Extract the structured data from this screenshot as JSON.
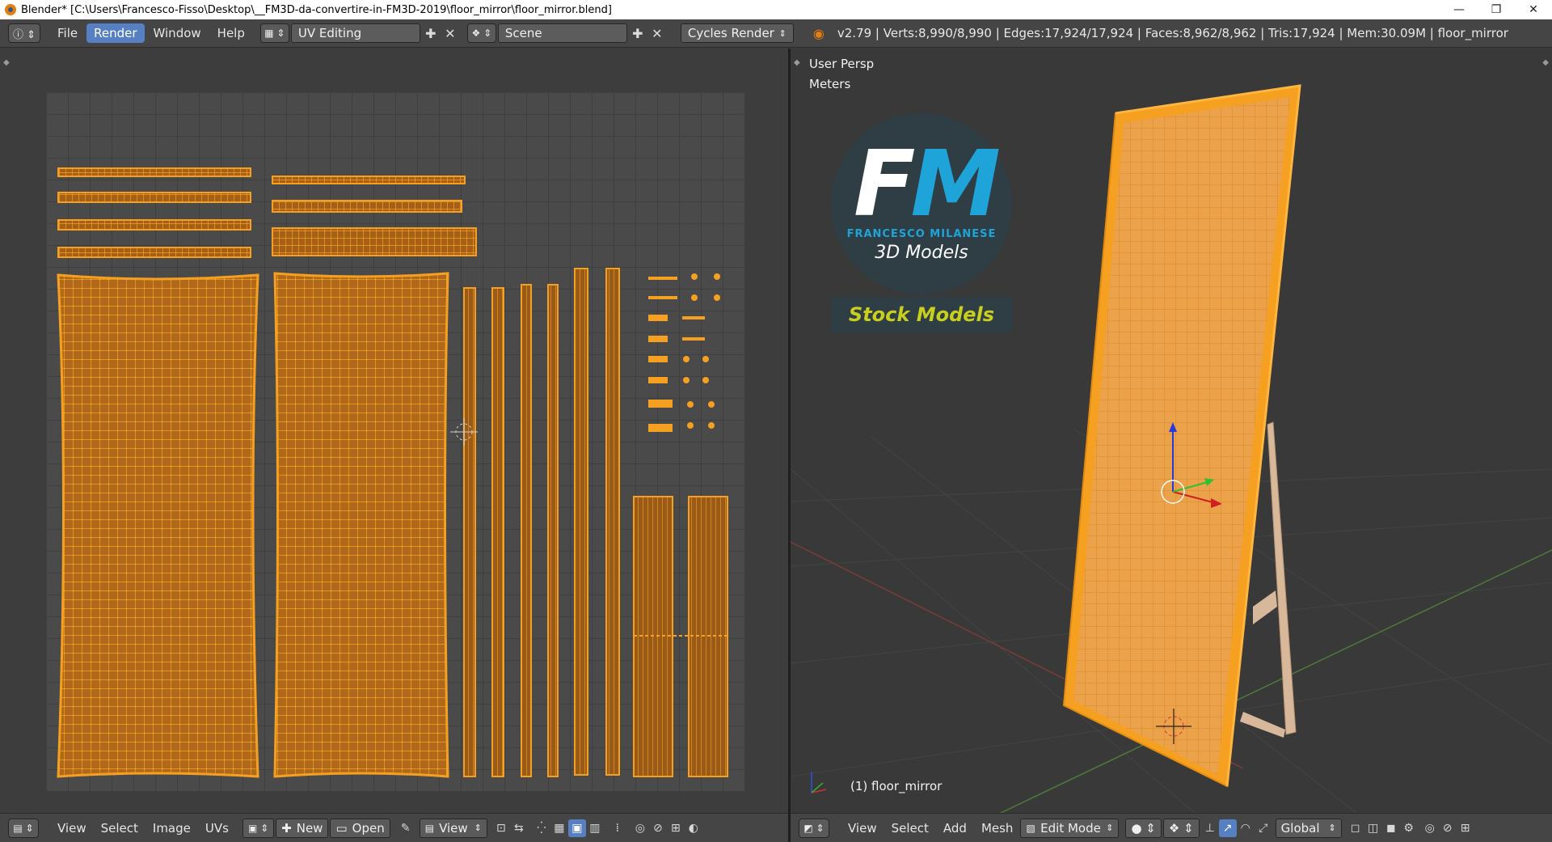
{
  "window": {
    "title": "Blender* [C:\\Users\\Francesco-Fisso\\Desktop\\__FM3D-da-convertire-in-FM3D-2019\\floor_mirror\\floor_mirror.blend]",
    "minimize": "—",
    "restore": "❐",
    "close": "✕"
  },
  "top_header": {
    "menus": [
      "File",
      "Render",
      "Window",
      "Help"
    ],
    "active_menu": "Render",
    "screen_layout": "UV Editing",
    "scene": "Scene",
    "render_engine": "Cycles Render",
    "stats": "v2.79 | Verts:8,990/8,990 | Edges:17,924/17,924 | Faces:8,962/8,962 | Tris:17,924 | Mem:30.09M | floor_mirror"
  },
  "uv_editor": {
    "menus": [
      "View",
      "Select",
      "Image",
      "UVs"
    ],
    "new_label": "New",
    "open_label": "Open",
    "view_label": "View"
  },
  "viewport": {
    "view_name": "User Persp",
    "units": "Meters",
    "object_label": "(1) floor_mirror",
    "menus": [
      "View",
      "Select",
      "Add",
      "Mesh"
    ],
    "mode": "Edit Mode",
    "orientation": "Global"
  },
  "logo": {
    "letter_f": "F",
    "letter_m": "M",
    "name": "FRANCESCO MILANESE",
    "subtitle": "3D Models",
    "stock": "Stock Models"
  },
  "colors": {
    "uv_orange": "#f5a020",
    "accent_blue": "#5680c2",
    "logo_blue": "#1ea4d8",
    "stock_yellow": "#c8cf1d"
  }
}
